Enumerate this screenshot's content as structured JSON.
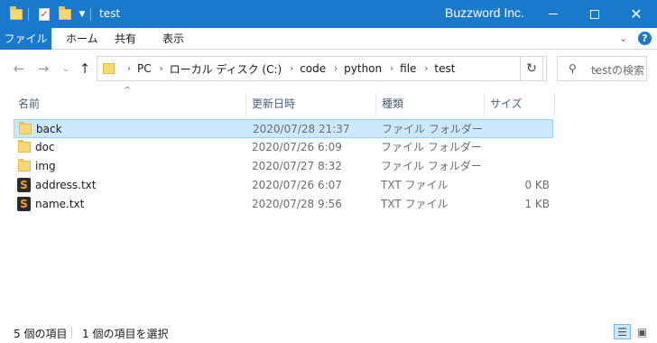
{
  "window": {
    "title": "test",
    "brand": "Buzzword Inc.",
    "accent": "#1979ca",
    "quick_access": [
      "folder-icon",
      "properties-icon",
      "new-folder-icon",
      "customize-dropdown-icon"
    ]
  },
  "ribbon": {
    "tabs": [
      "ファイル",
      "ホーム",
      "共有",
      "表示"
    ]
  },
  "address": {
    "crumbs": [
      "PC",
      "ローカル ディスク (C:)",
      "code",
      "python",
      "file",
      "test"
    ]
  },
  "search": {
    "placeholder": "testの検索"
  },
  "columns": [
    "名前",
    "更新日時",
    "種類",
    "サイズ"
  ],
  "files": [
    {
      "name": "back",
      "date": "2020/07/28 21:37",
      "type": "ファイル フォルダー",
      "size": "",
      "icon": "folder-icon",
      "selected": true
    },
    {
      "name": "doc",
      "date": "2020/07/26 6:09",
      "type": "ファイル フォルダー",
      "size": "",
      "icon": "folder-icon",
      "selected": false
    },
    {
      "name": "img",
      "date": "2020/07/27 8:32",
      "type": "ファイル フォルダー",
      "size": "",
      "icon": "folder-icon",
      "selected": false
    },
    {
      "name": "address.txt",
      "date": "2020/07/26 6:07",
      "type": "TXT ファイル",
      "size": "0 KB",
      "icon": "sublime-text-icon",
      "selected": false
    },
    {
      "name": "name.txt",
      "date": "2020/07/28 9:56",
      "type": "TXT ファイル",
      "size": "1 KB",
      "icon": "sublime-text-icon",
      "selected": false
    }
  ],
  "status": {
    "item_count": "5 個の項目",
    "selected_count": "1 個の項目を選択"
  }
}
